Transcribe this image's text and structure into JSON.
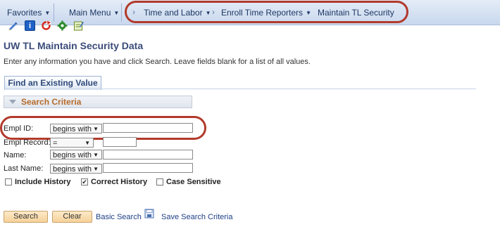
{
  "nav": {
    "favorites": "Favorites",
    "main_menu": "Main Menu",
    "breadcrumbs": [
      "Time and Labor",
      "Enroll Time Reporters",
      "Maintain TL Security"
    ]
  },
  "toolbar_icons": [
    "pencil-icon",
    "info-icon",
    "refresh-icon",
    "gear-icon",
    "notepad-icon"
  ],
  "page": {
    "title": "UW TL Maintain Security Data",
    "instructions": "Enter any information you have and click Search. Leave fields blank for a list of all values."
  },
  "tabs": {
    "find_existing": "Find an Existing Value"
  },
  "search_criteria": {
    "header": "Search Criteria",
    "fields": [
      {
        "label": "Empl ID:",
        "operator": "begins with",
        "value": ""
      },
      {
        "label": "Empl Record:",
        "operator": "=",
        "value": ""
      },
      {
        "label": "Name:",
        "operator": "begins with",
        "value": ""
      },
      {
        "label": "Last Name:",
        "operator": "begins with",
        "value": ""
      }
    ],
    "checkboxes": [
      {
        "label": "Include History",
        "checked": false
      },
      {
        "label": "Correct History",
        "checked": true
      },
      {
        "label": "Case Sensitive",
        "checked": false
      }
    ]
  },
  "actions": {
    "search": "Search",
    "clear": "Clear",
    "basic_search": "Basic Search",
    "save_search": "Save Search Criteria"
  },
  "colors": {
    "highlight_oval": "#b23a2b",
    "nav_bar": "#c9d8ee",
    "section_label": "#b56a2a",
    "button": "#f6d29a"
  }
}
